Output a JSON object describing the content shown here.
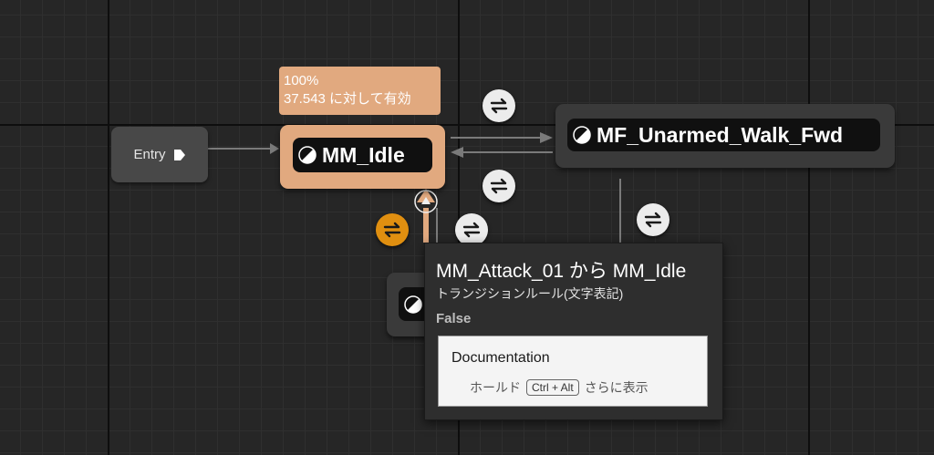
{
  "entry": {
    "label": "Entry"
  },
  "bubble": {
    "line1": "100%",
    "line2": "37.543 に対して有効"
  },
  "states": {
    "idle": {
      "label": "MM_Idle"
    },
    "walk": {
      "label": "MF_Unarmed_Walk_Fwd"
    }
  },
  "tooltip": {
    "title": "MM_Attack_01 から MM_Idle",
    "subtitle": "トランジションルール(文字表記)",
    "value": "False",
    "doc_title": "Documentation",
    "hint_before": "ホールド",
    "hint_key": "Ctrl + Alt",
    "hint_after": "さらに表示"
  },
  "colors": {
    "active_state": "#e1a97f",
    "active_transition": "#e08f10",
    "graph_background": "#262626",
    "wire": "#7a7a7a"
  },
  "icons": {
    "state": "half-circle-icon",
    "transition": "bidirectional-arrows-icon",
    "entry": "entry-arrow-icon"
  }
}
